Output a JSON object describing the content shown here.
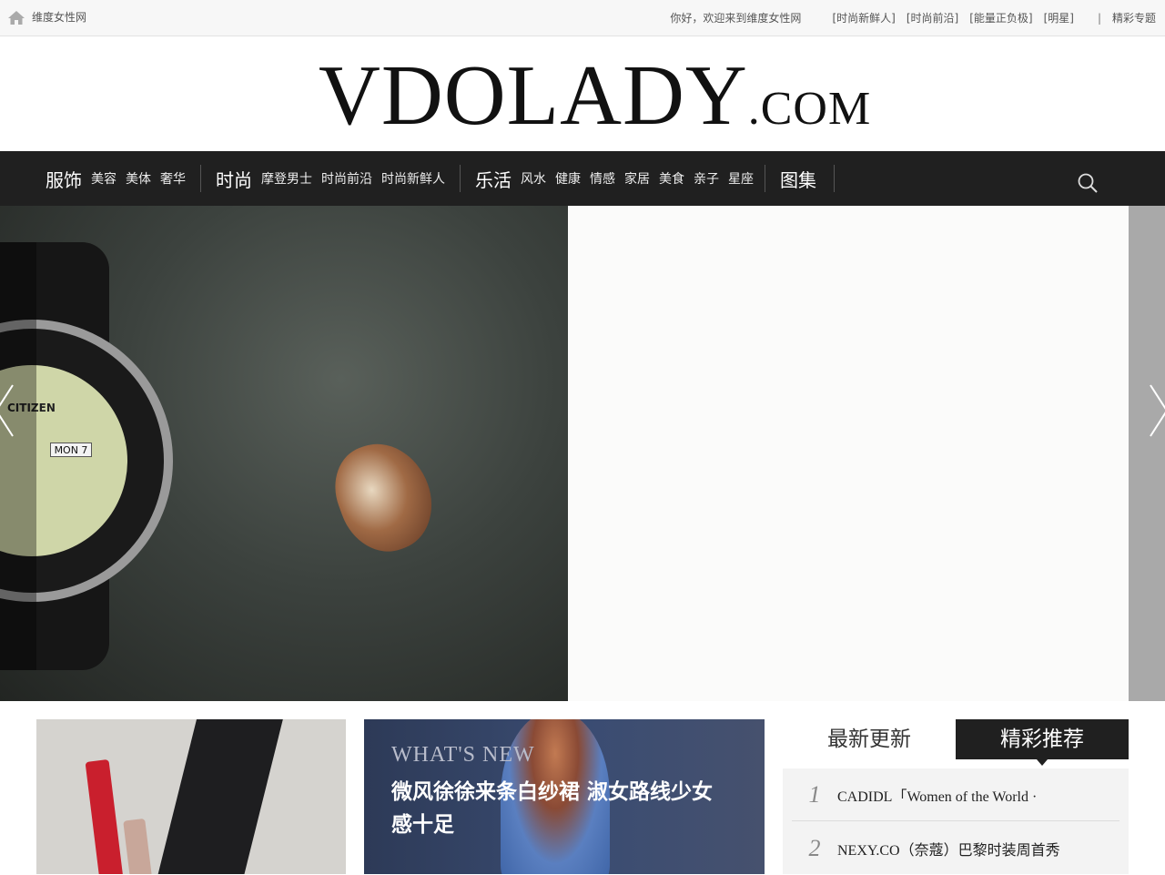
{
  "topbar": {
    "site_name": "维度女性网",
    "welcome": "你好，欢迎来到维度女性网",
    "links": [
      "[时尚新鲜人]",
      "[时尚前沿]",
      "[能量正负极]",
      "[明星]"
    ],
    "separator": "|",
    "special": "精彩专题"
  },
  "logo": {
    "main": "VDOLADY",
    "suffix": ".COM"
  },
  "nav": {
    "groups": [
      {
        "main": "服饰",
        "subs": [
          "美容",
          "美体",
          "奢华"
        ]
      },
      {
        "main": "时尚",
        "subs": [
          "摩登男士",
          "时尚前沿",
          "时尚新鲜人"
        ]
      },
      {
        "main": "乐活",
        "subs": [
          "风水",
          "健康",
          "情感",
          "家居",
          "美食",
          "亲子",
          "星座"
        ]
      },
      {
        "main": "图集",
        "subs": []
      }
    ]
  },
  "slider": {
    "watch_brand": "CITIZEN",
    "watch_date": "MON 7"
  },
  "feature": {
    "tag": "WHAT'S NEW",
    "title": "微风徐徐来条白纱裙 淑女路线少女感十足"
  },
  "tabs": {
    "latest": "最新更新",
    "featured": "精彩推荐"
  },
  "list": [
    {
      "num": "1",
      "title": "CADIDL「Women of the World ·"
    },
    {
      "num": "2",
      "title": "NEXY.CO（奈蔻）巴黎时装周首秀"
    }
  ],
  "colors": {
    "nav_bg": "#202020",
    "topbar_bg": "#f7f7f7"
  }
}
